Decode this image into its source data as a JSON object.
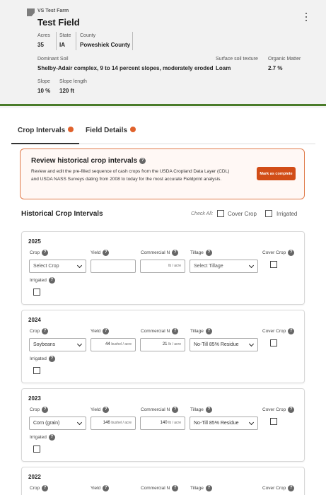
{
  "header": {
    "farm_name": "VS Test Farm",
    "field_name": "Test Field",
    "labels": {
      "acres": "Acres",
      "state": "State",
      "county": "County",
      "dominant_soil": "Dominant Soil",
      "surface_texture": "Surface soil texture",
      "organic_matter": "Organic Matter",
      "slope": "Slope",
      "slope_length": "Slope length"
    },
    "values": {
      "acres": "35",
      "state": "IA",
      "county": "Poweshiek County",
      "dominant_soil": "Shelby-Adair complex, 9 to 14 percent slopes, moderately eroded",
      "surface_texture": "Loam",
      "organic_matter": "2.7 %",
      "slope": "10 %",
      "slope_length": "120 ft"
    }
  },
  "tabs": [
    {
      "label": "Crop Intervals",
      "active": true,
      "has_alert": true
    },
    {
      "label": "Field Details",
      "active": false,
      "has_alert": true
    }
  ],
  "review": {
    "title": "Review historical crop intervals",
    "body": "Review and edit the pre-filled sequence of cash crops from the USDA Cropland Data Layer (CDL) and USDA NASS Surveys dating from 2008 to today for the most accurate Fieldprint analysis.",
    "button": "Mark as complete"
  },
  "historical": {
    "title": "Historical Crop Intervals",
    "check_all": "Check All:",
    "cover_crop": "Cover Crop",
    "irrigated": "Irrigated"
  },
  "field_labels": {
    "crop": "Crop",
    "yield": "Yield",
    "commercial_n": "Commercial N",
    "tillage": "Tillage",
    "cover_crop": "Cover Crop",
    "irrigated": "Irrigated"
  },
  "help_glyph": "?",
  "years": [
    {
      "year": "2025",
      "crop": "Select Crop",
      "yield": "",
      "yield_unit": "",
      "n": "",
      "n_unit": "lb / acre",
      "tillage": "Select Tillage",
      "cover_crop": false,
      "irrigated": false
    },
    {
      "year": "2024",
      "crop": "Soybeans",
      "yield": "44",
      "yield_unit": "bushel / acre",
      "n": "21",
      "n_unit": "lb / acre",
      "tillage": "No-Till 85% Residue",
      "cover_crop": false,
      "irrigated": false
    },
    {
      "year": "2023",
      "crop": "Corn (grain)",
      "yield": "146",
      "yield_unit": "bushel / acre",
      "n": "140",
      "n_unit": "lb / acre",
      "tillage": "No-Till 85% Residue",
      "cover_crop": false,
      "irrigated": false
    },
    {
      "year": "2022",
      "crop": "",
      "yield": "",
      "yield_unit": "",
      "n": "",
      "n_unit": "",
      "tillage": "",
      "cover_crop": false,
      "irrigated": false
    }
  ],
  "colors": {
    "accent": "#d24d17",
    "alert_dot": "#e0622c",
    "header_rule": "#4a7c2a"
  }
}
